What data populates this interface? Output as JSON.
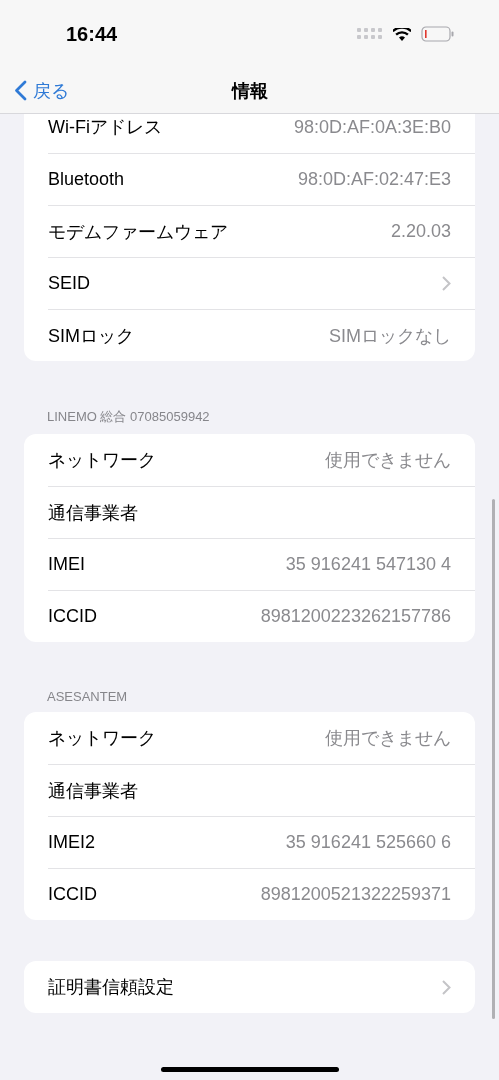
{
  "status_bar": {
    "time": "16:44"
  },
  "nav": {
    "back": "戻る",
    "title": "情報"
  },
  "sections": [
    {
      "rows": [
        {
          "kind": "value",
          "label": "Wi-Fiアドレス",
          "value": "98:0D:AF:0A:3E:B0"
        },
        {
          "kind": "value",
          "label": "Bluetooth",
          "value": "98:0D:AF:02:47:E3"
        },
        {
          "kind": "value",
          "label": "モデムファームウェア",
          "value": "2.20.03"
        },
        {
          "kind": "link",
          "label": "SEID"
        },
        {
          "kind": "value",
          "label": "SIMロック",
          "value": "SIMロックなし"
        }
      ]
    },
    {
      "header": "LINEMO 総合 07085059942",
      "rows": [
        {
          "kind": "value",
          "label": "ネットワーク",
          "value": "使用できません"
        },
        {
          "kind": "value",
          "label": "通信事業者"
        },
        {
          "kind": "value",
          "label": "IMEI",
          "value": "35 916241 547130 4"
        },
        {
          "kind": "value",
          "label": "ICCID",
          "value": "8981200223262157786"
        }
      ]
    },
    {
      "header": "ASESANTEM",
      "rows": [
        {
          "kind": "value",
          "label": "ネットワーク",
          "value": "使用できません"
        },
        {
          "kind": "value",
          "label": "通信事業者"
        },
        {
          "kind": "value",
          "label": "IMEI2",
          "value": "35 916241 525660 6"
        },
        {
          "kind": "value",
          "label": "ICCID",
          "value": "8981200521322259371"
        }
      ]
    },
    {
      "rows": [
        {
          "kind": "link",
          "label": "証明書信頼設定"
        }
      ]
    }
  ]
}
